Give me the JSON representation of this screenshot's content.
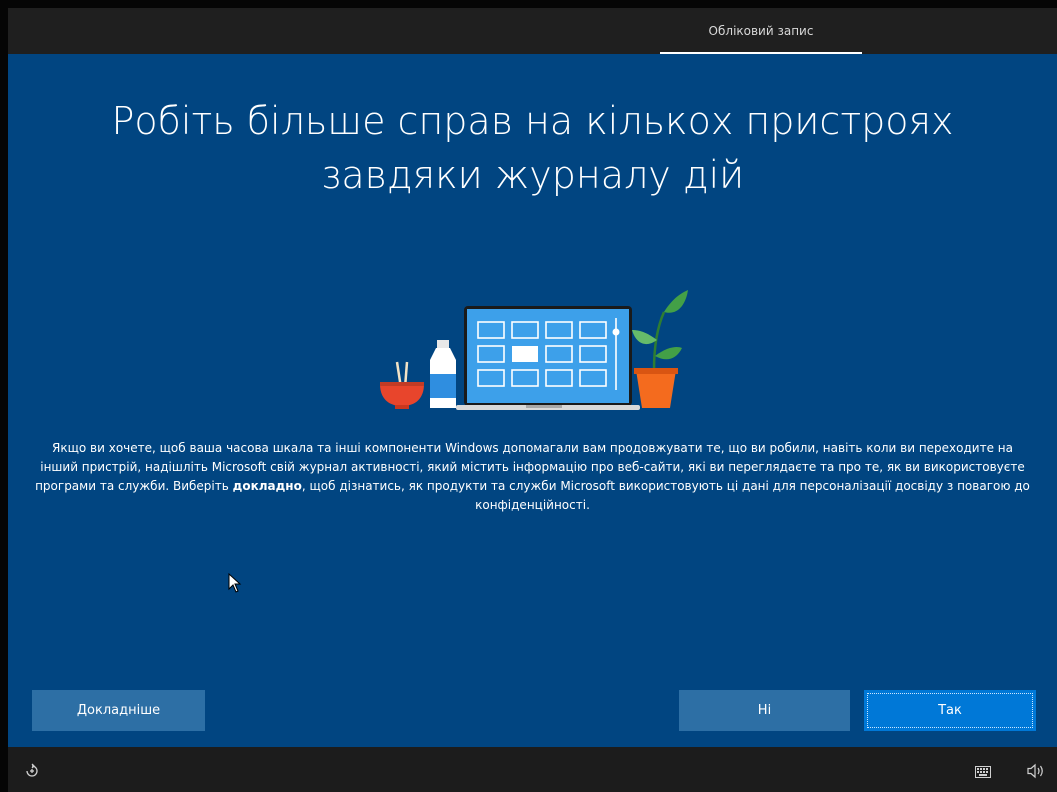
{
  "header": {
    "tab_label": "Обліковий запис"
  },
  "main": {
    "title_line1": "Робіть більше справ на кількох пристроях",
    "title_line2": "завдяки журналу дій",
    "description_part1": "Якщо ви хочете, щоб ваша часова шкала та інші компоненти Windows допомагали вам продовжувати те, що ви робили, навіть коли ви переходите на інший пристрій, надішліть Microsoft свій журнал активності, який містить інформацію про веб-сайти, які ви переглядаєте та про те, як ви використовуєте програми та служби. Виберіть ",
    "description_bold": "докладно",
    "description_part2": ", щоб дізнатись, як продукти та служби Microsoft використовують ці дані для персоналізації досвіду з повагою до конфіденційності."
  },
  "buttons": {
    "details_label": "Докладніше",
    "no_label": "Ні",
    "yes_label": "Так"
  },
  "icons": {
    "ease_of_access": "ease-of-access-icon",
    "keyboard": "keyboard-icon",
    "volume": "volume-icon"
  },
  "colors": {
    "background": "#014581",
    "primary_button": "#0078d7",
    "secondary_button": "#2d6fa5"
  }
}
